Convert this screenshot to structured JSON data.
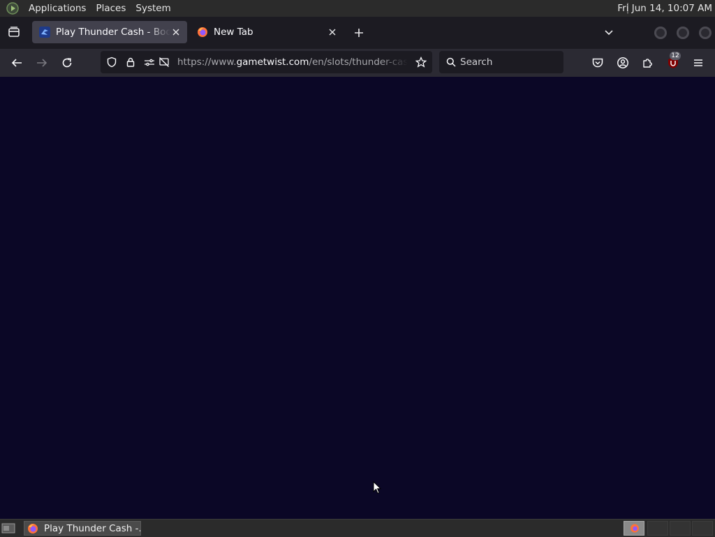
{
  "system_panel": {
    "menus": [
      "Applications",
      "Places",
      "System"
    ],
    "clock": "Fri Jun 14, 10:07 AM"
  },
  "tabs": [
    {
      "title": "Play Thunder Cash - Book of Ra",
      "active": true,
      "favicon": "gametwist-icon"
    },
    {
      "title": "New Tab",
      "active": false,
      "favicon": "firefox-icon"
    }
  ],
  "navbar": {
    "url_prefix": "https://www.",
    "url_host": "gametwist.com",
    "url_path": "/en/slots/thunder-cash-book-of-ra/",
    "search_placeholder": "Search",
    "extension_badge": "12"
  },
  "taskbar": {
    "window_label": "Play Thunder Cash -..."
  },
  "colors": {
    "page_background": "#0b0726",
    "tab_active": "#42414d",
    "toolbar": "#2b2a33",
    "urlbar": "#1c1b22"
  }
}
